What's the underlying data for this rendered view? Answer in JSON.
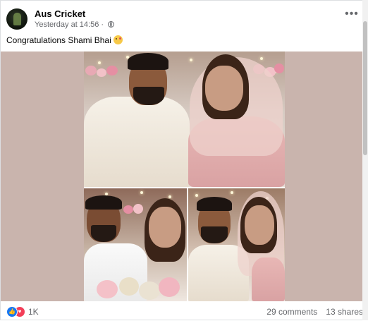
{
  "post": {
    "page_name": "Aus Cricket",
    "timestamp": "Yesterday at 14:56",
    "separator": "·",
    "privacy_icon": "globe-icon",
    "more_icon": "ellipsis-icon",
    "text": "Congratulations Shami Bhai",
    "emoji": "kissing-face-emoji"
  },
  "media": {
    "photos": [
      "couple-photo-top",
      "couple-photo-bottom-left",
      "couple-photo-bottom-right"
    ]
  },
  "footer": {
    "reaction_icons": [
      "like-icon",
      "love-icon"
    ],
    "reaction_count": "1K",
    "comments": "29 comments",
    "shares": "13 shares"
  },
  "colors": {
    "like": "#1877f2",
    "love": "#f33e58",
    "meta_text": "#65676b"
  }
}
